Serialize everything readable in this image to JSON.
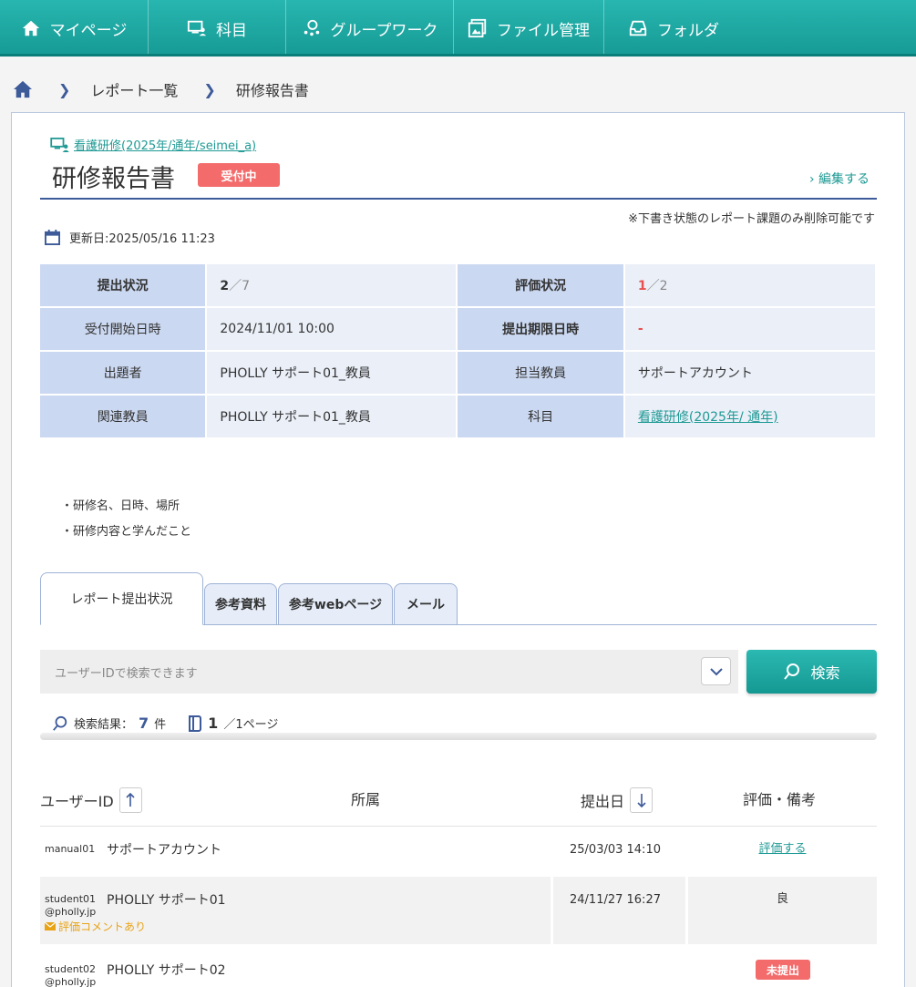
{
  "nav": {
    "items": [
      {
        "label": "マイページ",
        "icon": "home-icon"
      },
      {
        "label": "科目",
        "icon": "course-icon"
      },
      {
        "label": "グループワーク",
        "icon": "group-icon"
      },
      {
        "label": "ファイル管理",
        "icon": "file-icon"
      },
      {
        "label": "フォルダ",
        "icon": "folder-icon"
      }
    ]
  },
  "breadcrumb": {
    "items": [
      "レポート一覧",
      "研修報告書"
    ]
  },
  "report": {
    "course_link": "看護研修(2025年/通年/seimei_a)",
    "title": "研修報告書",
    "status_badge": "受付中",
    "edit_label": "編集する",
    "delete_note": "※下書き状態のレポート課題のみ削除可能です",
    "updated": "更新日:2025/05/16 11:23"
  },
  "info": {
    "submit_status_label": "提出状況",
    "submit_count": "2",
    "submit_total": "／7",
    "eval_status_label": "評価状況",
    "eval_count": "1",
    "eval_total": "／2",
    "start_label": "受付開始日時",
    "start_value": "2024/11/01 10:00",
    "deadline_label": "提出期限日時",
    "deadline_value": "-",
    "author_label": "出題者",
    "author_value": "PHOLLY サポート01_教員",
    "teacher_label": "担当教員",
    "teacher_value": "サポートアカウント",
    "related_label": "関連教員",
    "related_value": "PHOLLY サポート01_教員",
    "subject_label": "科目",
    "subject_value": "看護研修(2025年/ 通年)"
  },
  "description": [
    "・研修名、日時、場所",
    "・研修内容と学んだこと"
  ],
  "tabs": [
    "レポート提出状況",
    "参考資料",
    "参考webページ",
    "メール"
  ],
  "search": {
    "placeholder": "ユーザーIDで検索できます",
    "button_label": "検索",
    "results_label": "検索結果：",
    "results_count": "7",
    "results_unit": "件",
    "page_current": "1",
    "page_total": "／1ページ"
  },
  "list": {
    "headers": {
      "user_id": "ユーザーID",
      "affiliation": "所属",
      "date": "提出日",
      "eval": "評価・備考"
    },
    "rows": [
      {
        "id": "manual01",
        "name": "サポートアカウント",
        "date": "25/03/03 14:10",
        "eval": "評価する"
      },
      {
        "id": "student01",
        "id2": "@pholly.jp",
        "name": "PHOLLY サポート01",
        "date": "24/11/27 16:27",
        "eval": "良",
        "comment": "評価コメントあり"
      },
      {
        "id": "student02",
        "id2": "@pholly.jp",
        "name": "PHOLLY サポート02",
        "badge": "未提出"
      }
    ]
  },
  "colors": {
    "teal": "#1f9a94",
    "navy": "#3d5a99",
    "red": "#f36b6b",
    "header_blue": "#cbd8f1"
  }
}
